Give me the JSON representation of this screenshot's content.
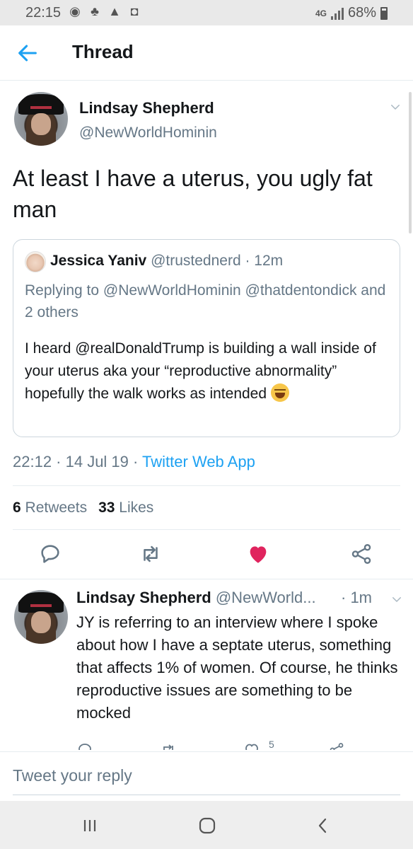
{
  "status_bar": {
    "time": "22:15",
    "network": "4G",
    "battery": "68%"
  },
  "header": {
    "title": "Thread"
  },
  "main_tweet": {
    "name": "Lindsay Shepherd",
    "handle": "@NewWorldHominin",
    "text": "At least I have a uterus, you ugly fat man",
    "timestamp": "22:12 · 14 Jul 19 · ",
    "source": "Twitter Web App",
    "retweets_count": "6",
    "retweets_label": "Retweets",
    "likes_count": "33",
    "likes_label": "Likes",
    "liked": true
  },
  "quoted_tweet": {
    "name": "Jessica Yaniv",
    "meta": "@trustednerd · 12m",
    "replying_prefix": "Replying to ",
    "replying_to": "@NewWorldHominin @thatdentondick and 2 others",
    "text": "I heard @realDonaldTrump is building a wall inside of your uterus aka your “reproductive abnormality” hopefully the walk works as intended"
  },
  "reply_tweet": {
    "name": "Lindsay Shepherd",
    "handle": "@NewWorld...",
    "time": "· 1m",
    "text": "JY is referring to an interview where I spoke about how I have a septate uterus, something that affects 1% of women. Of course, he thinks reproductive issues are something to be mocked",
    "likes_count": "5"
  },
  "compose": {
    "placeholder": "Tweet your reply"
  },
  "colors": {
    "accent": "#1da1f2",
    "like": "#e0245e",
    "muted": "#657786"
  }
}
